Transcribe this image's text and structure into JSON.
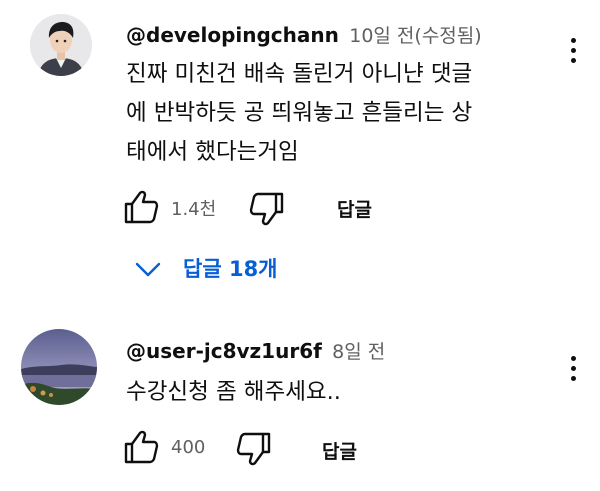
{
  "comments": [
    {
      "handle": "@developingchann",
      "meta": "10일 전(수정됨)",
      "lines": [
        "진짜 미친건 배속 돌린거 아니냔 댓글",
        "에 반박하듯 공 띄워놓고 흔들리는 상",
        "태에서 했다는거임"
      ],
      "like_count": "1.4천",
      "reply_label": "답글",
      "replies_label": "답글 18개",
      "avatar_icon": "profile-photo-boy"
    },
    {
      "handle": "@user-jc8vz1ur6f",
      "meta": "8일 전",
      "lines": [
        "수강신청 좀 해주세요.."
      ],
      "like_count": "400",
      "reply_label": "답글",
      "avatar_icon": "landscape-photo"
    }
  ],
  "icons": {
    "like": "thumbs-up-icon",
    "dislike": "thumbs-down-icon",
    "menu": "more-vert-icon",
    "expand": "chevron-down-icon"
  },
  "colors": {
    "link_blue": "#065fd4",
    "meta_gray": "#606060"
  }
}
